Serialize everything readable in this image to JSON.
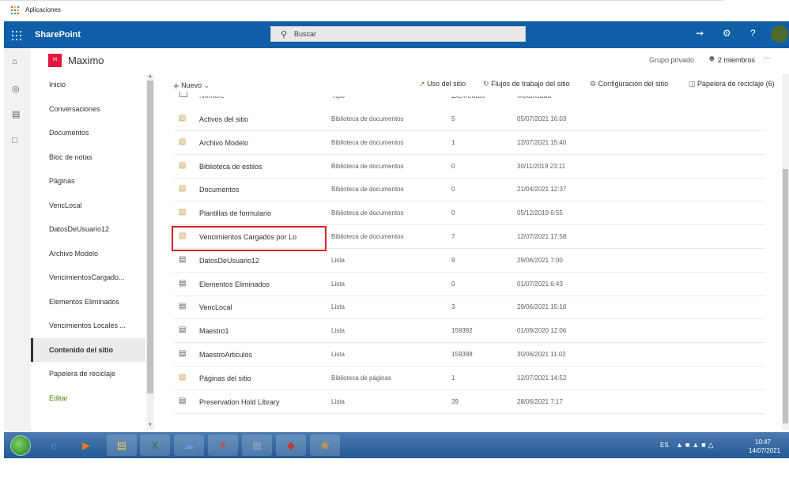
{
  "browser": {
    "apps_label": "Aplicaciones",
    "apps_icon": "grid-icon"
  },
  "suite": {
    "title": "SharePoint",
    "search_placeholder": "Buscar",
    "icons": [
      "megaphone-icon",
      "gear-icon",
      "help-icon",
      "avatar"
    ]
  },
  "site": {
    "logo_letter": "M",
    "name": "Maximo",
    "privacy": "Grupo privado",
    "members": "2 miembros",
    "more": "···"
  },
  "nav": {
    "items": [
      "Inicio",
      "Conversaciones",
      "Documentos",
      "Bloc de notas",
      "Páginas",
      "VencLocal",
      "DatosDeUsuario12",
      "Archivo Modelo",
      "VencimientosCargado...",
      "Elementos Eliminados",
      "Vencimientos Locales ...",
      "Contenido del sitio",
      "Papelera de reciclaje"
    ],
    "selected": "Contenido del sitio",
    "edit": "Editar"
  },
  "commands": {
    "new": "Nuevo",
    "site_usage": "Uso del sitio",
    "workflows": "Flujos de trabajo del sitio",
    "site_settings": "Configuración del sitio",
    "recycle_bin": "Papelera de reciclaje (6)"
  },
  "list": {
    "headers": [
      "Nombre",
      "Tipo",
      "Elementos",
      "Modificado"
    ],
    "rows": [
      {
        "name": "Activos del sitio",
        "type": "Biblioteca de documentos",
        "count": "5",
        "modified": "05/07/2021 16:03",
        "icon": "library-icon"
      },
      {
        "name": "Archivo Modelo",
        "type": "Biblioteca de documentos",
        "count": "1",
        "modified": "12/07/2021 15:40",
        "icon": "library-icon"
      },
      {
        "name": "Biblioteca de estilos",
        "type": "Biblioteca de documentos",
        "count": "0",
        "modified": "30/11/2019 23:11",
        "icon": "library-icon"
      },
      {
        "name": "Documentos",
        "type": "Biblioteca de documentos",
        "count": "0",
        "modified": "21/04/2021 12:37",
        "icon": "library-icon"
      },
      {
        "name": "Plantillas de formulario",
        "type": "Biblioteca de documentos",
        "count": "0",
        "modified": "05/12/2019 6:55",
        "icon": "library-icon"
      },
      {
        "name": "Vencimientos Cargados por Lo",
        "type": "Biblioteca de documentos",
        "count": "7",
        "modified": "12/07/2021 17:58",
        "icon": "library-icon"
      },
      {
        "name": "DatosDeUsuario12",
        "type": "Lista",
        "count": "9",
        "modified": "29/06/2021 7:00",
        "icon": "list-icon"
      },
      {
        "name": "Elementos Eliminados",
        "type": "Lista",
        "count": "0",
        "modified": "01/07/2021 6:43",
        "icon": "list-icon"
      },
      {
        "name": "VencLocal",
        "type": "Lista",
        "count": "3",
        "modified": "29/06/2021 15:10",
        "icon": "list-icon"
      },
      {
        "name": "Maestro1",
        "type": "Lista",
        "count": "159392",
        "modified": "01/09/2020 12:06",
        "icon": "list-icon"
      },
      {
        "name": "MaestroArticulos",
        "type": "Lista",
        "count": "159398",
        "modified": "30/06/2021 11:02",
        "icon": "list-icon"
      },
      {
        "name": "Páginas del sitio",
        "type": "Biblioteca de páginas",
        "count": "1",
        "modified": "12/07/2021 14:52",
        "icon": "library-icon"
      },
      {
        "name": "Preservation Hold Library",
        "type": "Lista",
        "count": "39",
        "modified": "28/06/2021 7:17",
        "icon": "list-icon"
      }
    ]
  },
  "taskbar": {
    "apps": [
      "ie-icon",
      "media-player-icon",
      "explorer-icon",
      "excel-icon",
      "onedrive-icon",
      "app-icon",
      "calculator-icon",
      "app2-icon",
      "paint-icon"
    ],
    "lang": "ES",
    "time": "10:47",
    "date": "14/07/2021"
  },
  "colors": {
    "suite_bar": "#0f5ea8",
    "accent_green": "#498205",
    "site_logo": "#e3173e",
    "highlight": "#e02020"
  }
}
